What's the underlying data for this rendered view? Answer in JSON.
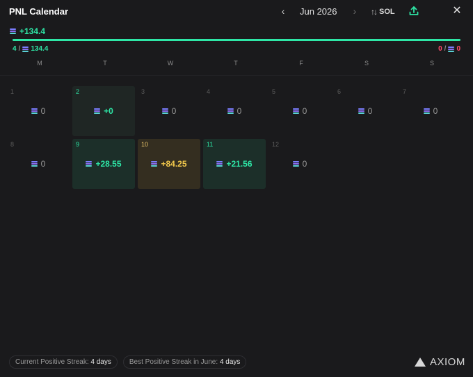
{
  "header": {
    "title": "PNL Calendar",
    "month": "Jun 2026",
    "currency": "SOL"
  },
  "total": {
    "value": "+134.4"
  },
  "progress": {
    "win_fraction": 1.0
  },
  "wins": {
    "count": "4",
    "separator": "/",
    "amount": "134.4"
  },
  "losses": {
    "count": "0",
    "separator": "/",
    "amount": "0"
  },
  "weekdays": [
    "M",
    "T",
    "W",
    "T",
    "F",
    "S",
    "S"
  ],
  "days": [
    {
      "day": "1",
      "value": "0",
      "state": "none"
    },
    {
      "day": "2",
      "value": "+0",
      "state": "zero-hl"
    },
    {
      "day": "3",
      "value": "0",
      "state": "none"
    },
    {
      "day": "4",
      "value": "0",
      "state": "none"
    },
    {
      "day": "5",
      "value": "0",
      "state": "none"
    },
    {
      "day": "6",
      "value": "0",
      "state": "none"
    },
    {
      "day": "7",
      "value": "0",
      "state": "none"
    },
    {
      "day": "8",
      "value": "0",
      "state": "none"
    },
    {
      "day": "9",
      "value": "+28.55",
      "state": "pos"
    },
    {
      "day": "10",
      "value": "+84.25",
      "state": "best"
    },
    {
      "day": "11",
      "value": "+21.56",
      "state": "pos"
    },
    {
      "day": "12",
      "value": "0",
      "state": "none"
    }
  ],
  "footer": {
    "current_streak_label": "Current Positive Streak:",
    "current_streak_value": "4 days",
    "best_streak_label": "Best Positive Streak in June:",
    "best_streak_value": "4 days"
  },
  "brand": {
    "name": "AXIOM"
  },
  "colors": {
    "positive": "#2ee6a6",
    "negative": "#ff4a6b",
    "best": "#f2c94c"
  },
  "icons": {
    "prev": "chevron-left-icon",
    "next": "chevron-right-icon",
    "sort": "sort-arrows-icon",
    "share": "share-upload-icon",
    "close": "close-icon",
    "currency": "solana-icon",
    "brand": "axiom-logo-icon"
  }
}
